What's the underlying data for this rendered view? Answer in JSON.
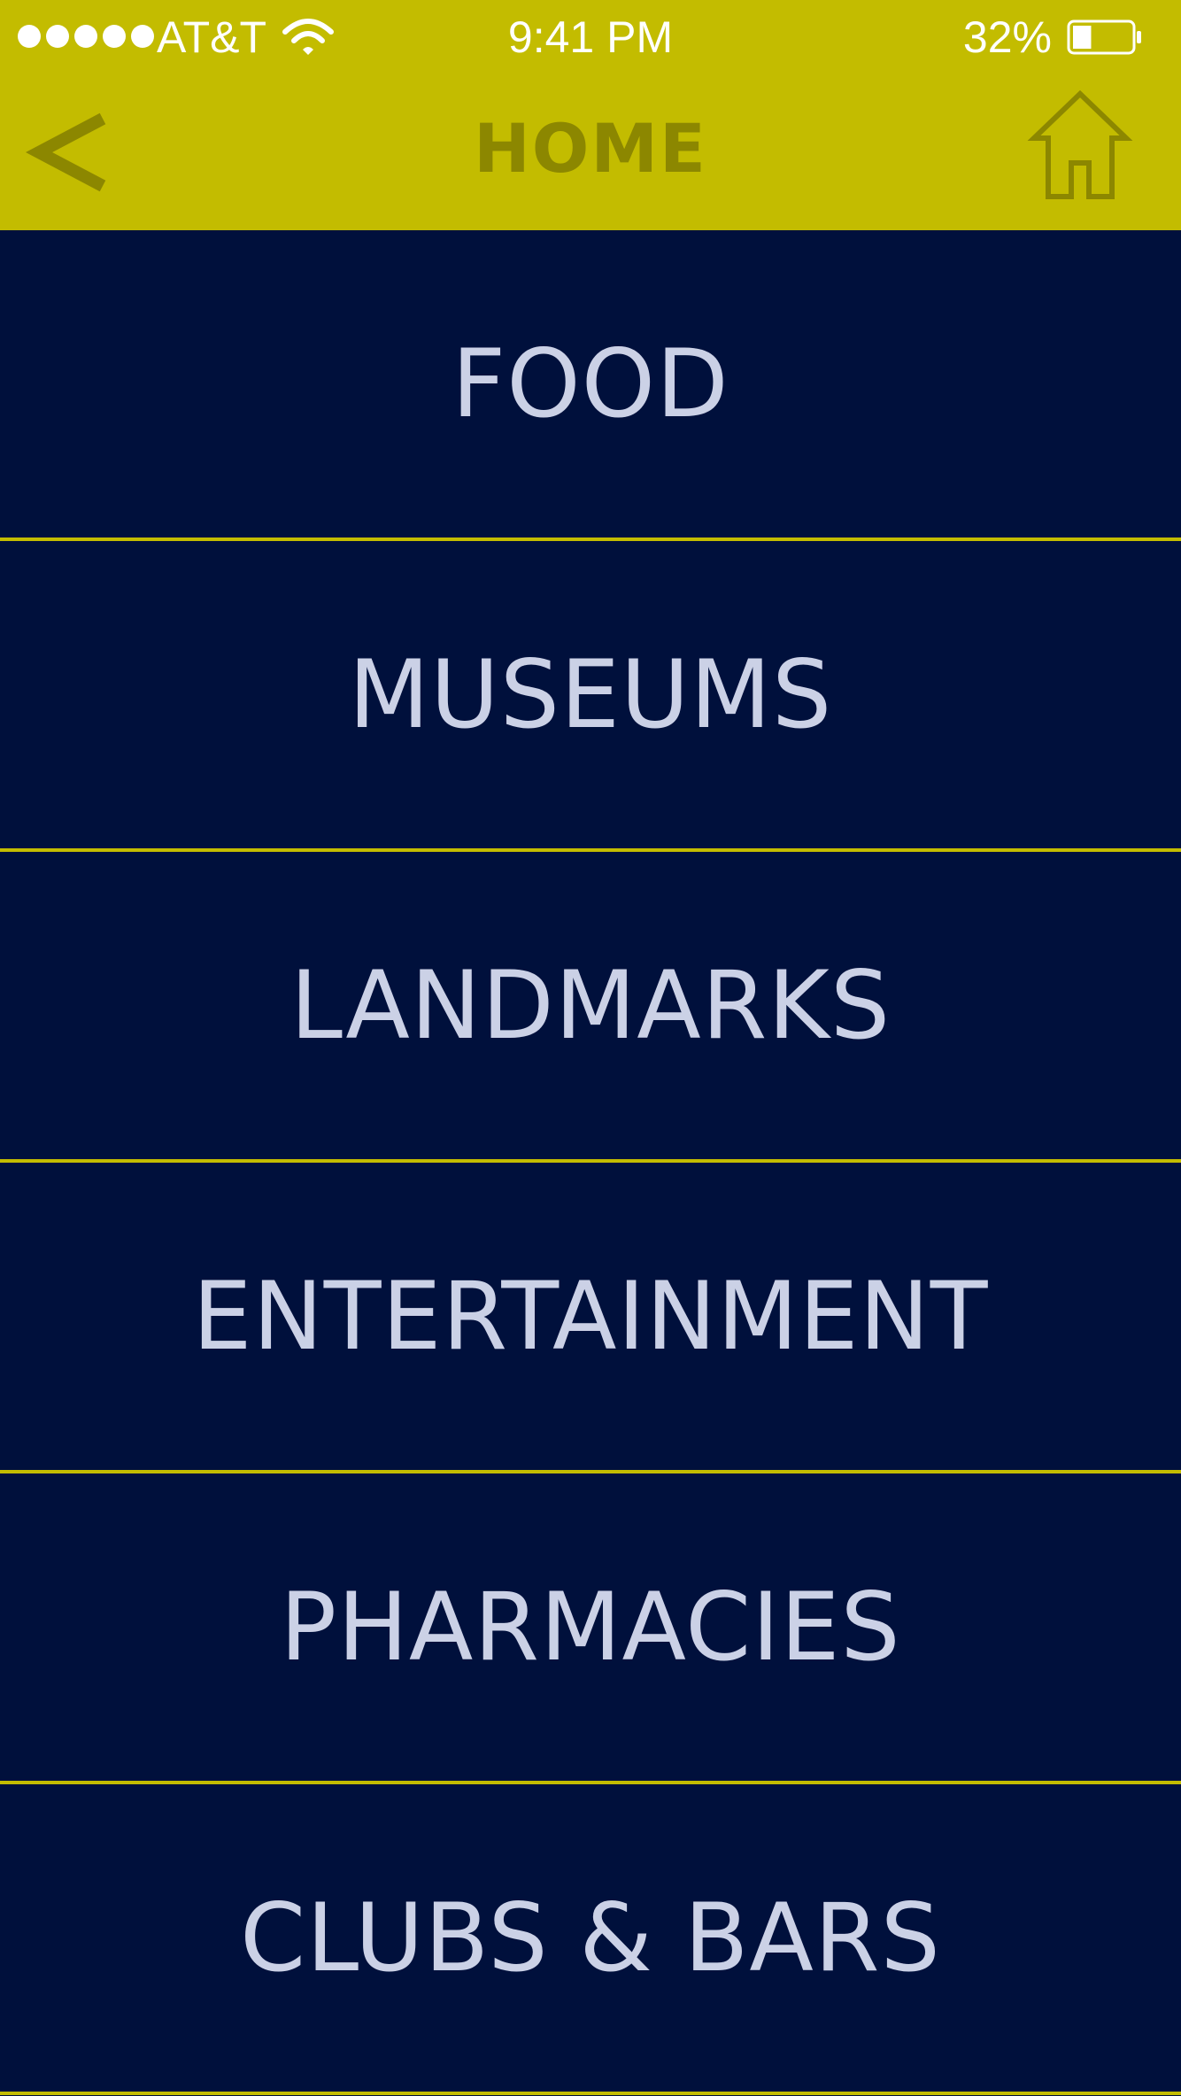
{
  "status_bar": {
    "carrier": "AT&T",
    "time": "9:41 PM",
    "battery": "32%",
    "battery_level": 0.32
  },
  "nav": {
    "title": "HOME",
    "back_icon": "chevron-left-icon",
    "home_icon": "home-icon"
  },
  "menu": {
    "items": [
      {
        "label": "FOOD"
      },
      {
        "label": "MUSEUMS"
      },
      {
        "label": "LANDMARKS"
      },
      {
        "label": "ENTERTAINMENT"
      },
      {
        "label": "PHARMACIES"
      },
      {
        "label": "CLUBS & BARS"
      }
    ]
  },
  "colors": {
    "header": "#c3bc00",
    "background": "#00103c",
    "divider": "#c3bc00",
    "label": "#cbd1e6",
    "nav_icon": "#8c8700"
  }
}
